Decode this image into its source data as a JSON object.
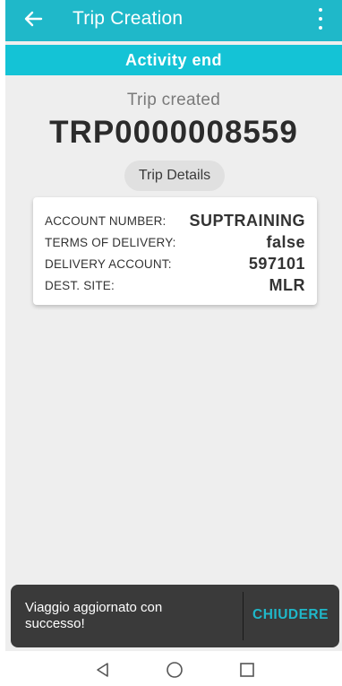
{
  "appbar": {
    "title": "Trip Creation",
    "back_icon": "arrow-left-icon",
    "more_icon": "more-vertical-icon",
    "color": "#1fb8c9"
  },
  "activity_header": "Activity end",
  "trip": {
    "status": "Trip created",
    "id": "TRP0000008559",
    "details_button": "Trip Details"
  },
  "details": [
    {
      "label": "ACCOUNT NUMBER:",
      "value": "SUPTRAINING"
    },
    {
      "label": "TERMS OF DELIVERY:",
      "value": "false"
    },
    {
      "label": "DELIVERY ACCOUNT:",
      "value": "597101"
    },
    {
      "label": "DEST. SITE:",
      "value": "MLR"
    }
  ],
  "snackbar": {
    "message": "Viaggio aggiornato con successo!",
    "action": "CHIUDERE"
  },
  "navbar": {
    "back_icon": "triangle-back-icon",
    "home_icon": "circle-home-icon",
    "recents_icon": "square-recents-icon"
  }
}
